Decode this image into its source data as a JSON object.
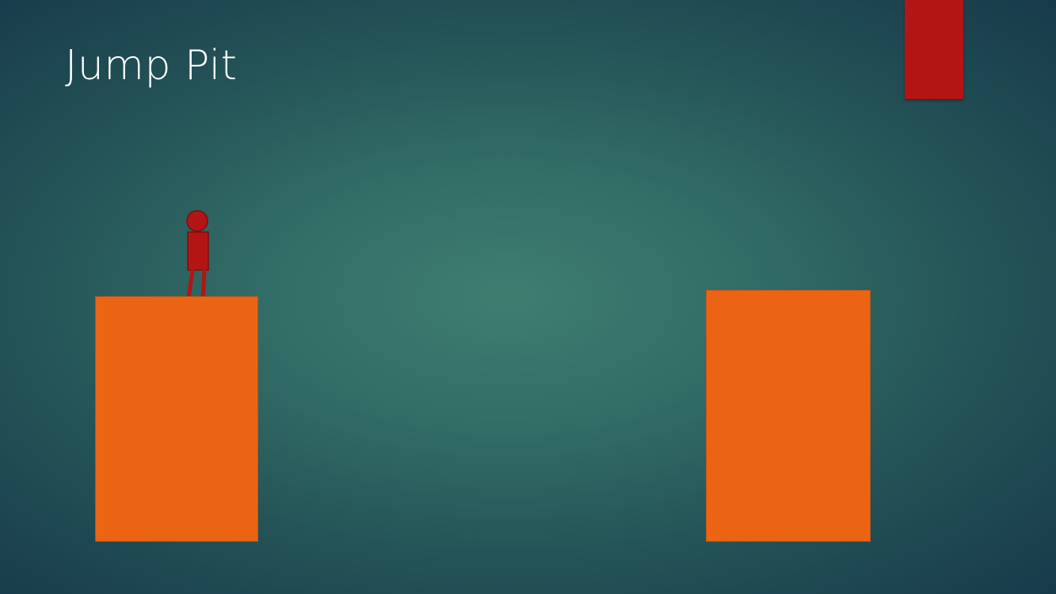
{
  "slide": {
    "title": "Jump Pit"
  },
  "colors": {
    "background_center": "#3f7d71",
    "background_edge": "#173a4a",
    "accent_bar": "#b31515",
    "platform_fill": "#eb6414",
    "character": "#b31515",
    "title_text": "#ffffff"
  }
}
